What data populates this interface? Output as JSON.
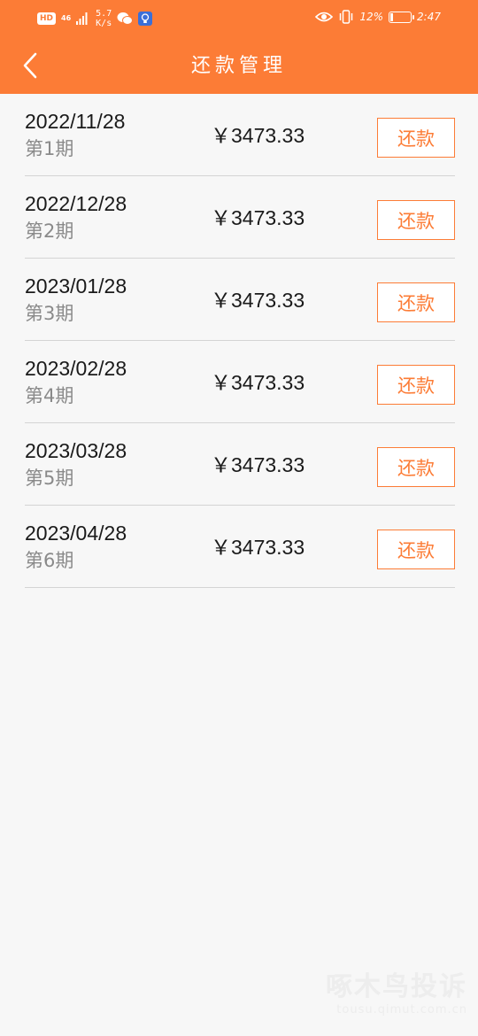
{
  "status_bar": {
    "hd": "HD",
    "network": "46",
    "speed_value": "5.7",
    "speed_unit": "K/s",
    "battery_percent": "12%",
    "battery_level": 0.12,
    "time": "2:47"
  },
  "header": {
    "title": "还款管理"
  },
  "colors": {
    "accent": "#fc7c36",
    "background": "#f7f7f7",
    "divider": "#d4d4d4"
  },
  "items": [
    {
      "date": "2022/11/28",
      "period": "第1期",
      "amount": "￥3473.33",
      "button": "还款"
    },
    {
      "date": "2022/12/28",
      "period": "第2期",
      "amount": "￥3473.33",
      "button": "还款"
    },
    {
      "date": "2023/01/28",
      "period": "第3期",
      "amount": "￥3473.33",
      "button": "还款"
    },
    {
      "date": "2023/02/28",
      "period": "第4期",
      "amount": "￥3473.33",
      "button": "还款"
    },
    {
      "date": "2023/03/28",
      "period": "第5期",
      "amount": "￥3473.33",
      "button": "还款"
    },
    {
      "date": "2023/04/28",
      "period": "第6期",
      "amount": "￥3473.33",
      "button": "还款"
    }
  ],
  "watermark": {
    "main": "啄木鸟投诉",
    "sub": "tousu.qimut.com.cn"
  }
}
